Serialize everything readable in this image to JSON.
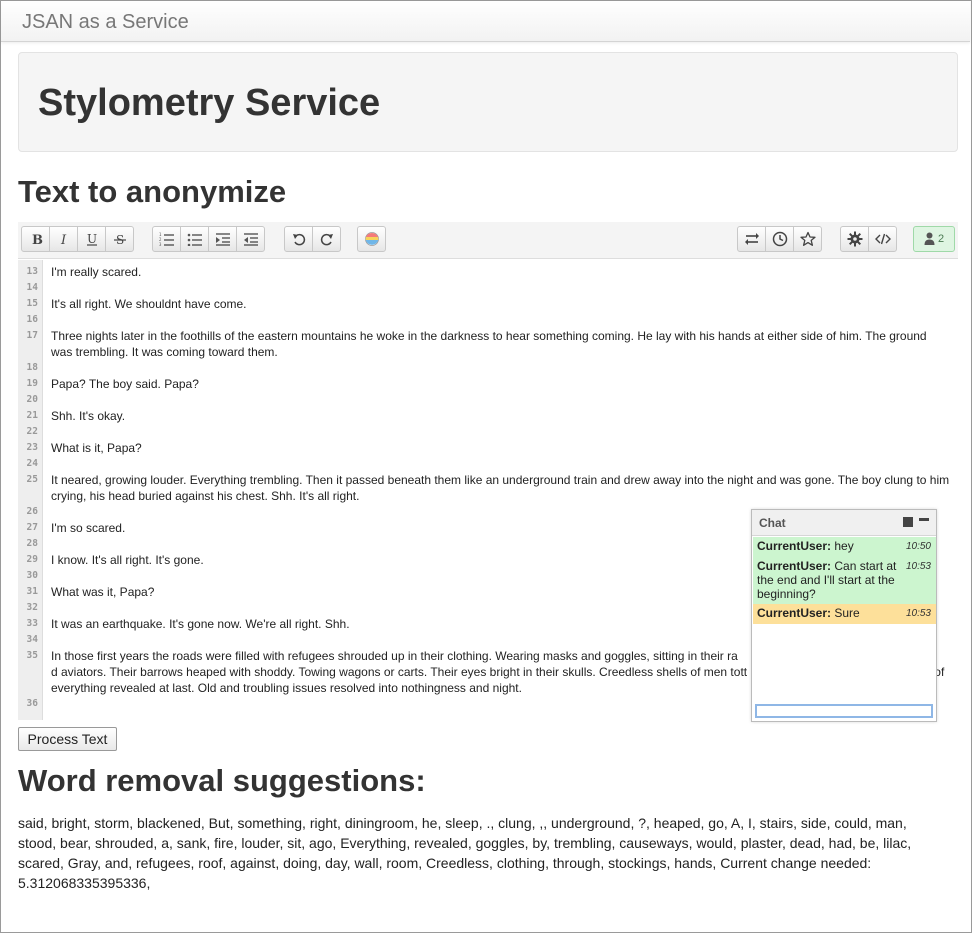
{
  "navbar": {
    "brand": "JSAN as a Service"
  },
  "hero": {
    "title": "Stylometry Service"
  },
  "sections": {
    "text_heading": "Text to anonymize",
    "suggestions_heading": "Word removal suggestions:"
  },
  "toolbar": {
    "format": [
      "bold-icon",
      "italic-icon",
      "underline-icon",
      "strikethrough-icon"
    ],
    "lists": [
      "ordered-list-icon",
      "unordered-list-icon",
      "indent-icon",
      "outdent-icon"
    ],
    "history": [
      "undo-icon",
      "redo-icon"
    ],
    "color": "color-palette-icon",
    "right": [
      "swap-icon",
      "clock-icon",
      "star-icon"
    ],
    "settings": [
      "gear-icon",
      "code-icon"
    ],
    "users_count": "2",
    "users_color": "#dff5e2"
  },
  "editor": {
    "lines": [
      {
        "n": "13",
        "text": "I'm really scared."
      },
      {
        "n": "14",
        "text": ""
      },
      {
        "n": "15",
        "text": "It's all right. We shouldnt have come."
      },
      {
        "n": "16",
        "text": ""
      },
      {
        "n": "17",
        "text": "Three nights later in the foothills of the eastern mountains he woke in the darkness to hear something coming. He lay with his hands at either side of him. The ground was trembling. It was coming toward them."
      },
      {
        "n": "18",
        "text": ""
      },
      {
        "n": "19",
        "text": "Papa? The boy said. Papa?"
      },
      {
        "n": "20",
        "text": ""
      },
      {
        "n": "21",
        "text": "Shh. It's okay."
      },
      {
        "n": "22",
        "text": ""
      },
      {
        "n": "23",
        "text": "What is it, Papa?"
      },
      {
        "n": "24",
        "text": ""
      },
      {
        "n": "25",
        "text": "It neared, growing louder. Everything trembling. Then it passed beneath them like an underground train and drew away into the night and was gone. The boy clung to him crying, his head buried against his chest. Shh. It's all right."
      },
      {
        "n": "26",
        "text": ""
      },
      {
        "n": "27",
        "text": "I'm so scared."
      },
      {
        "n": "28",
        "text": ""
      },
      {
        "n": "29",
        "text": "I know. It's all right. It's gone."
      },
      {
        "n": "30",
        "text": ""
      },
      {
        "n": "31",
        "text": "What was it, Papa?"
      },
      {
        "n": "32",
        "text": ""
      },
      {
        "n": "33",
        "text": "It was an earthquake. It's gone now. We're all right. Shh."
      },
      {
        "n": "34",
        "text": ""
      },
      {
        "n": "35",
        "text": "In those first years the roads were filled with refugees shrouded up in their clothing. Wearing masks and goggles, sitting in their ra                                                                    d aviators. Their barrows heaped with shoddy. Towing wagons or carts. Their eyes bright in their skulls. Creedless shells of men tott migrants in a feverland. The frailty of everything revealed at last. Old and troubling issues resolved into nothingness and night."
      },
      {
        "n": "36",
        "text": ""
      }
    ]
  },
  "chat": {
    "title": "Chat",
    "messages": [
      {
        "user": "CurrentUser:",
        "text": "hey",
        "time": "10:50",
        "color": "#ccf5cf"
      },
      {
        "user": "CurrentUser:",
        "text": "Can start at the end and I'll start at the beginning?",
        "time": "10:53",
        "color": "#ccf5cf"
      },
      {
        "user": "CurrentUser:",
        "text": "Sure",
        "time": "10:53",
        "color": "#fde09a"
      }
    ],
    "input_value": ""
  },
  "process_button": "Process Text",
  "suggestions": "said, bright, storm, blackened, But, something, right, diningroom, he, sleep, ., clung, ,, underground, ?, heaped, go, A, I, stairs, side, could, man, stood, bear, shrouded, a, sank, fire, louder, sit, ago, Everything, revealed, goggles, by, trembling, causeways, would, plaster, dead, had, be, lilac, scared, Gray, and, refugees, roof, against, doing, day, wall, room, Creedless, clothing, through, stockings, hands, Current change needed: 5.312068335395336,"
}
